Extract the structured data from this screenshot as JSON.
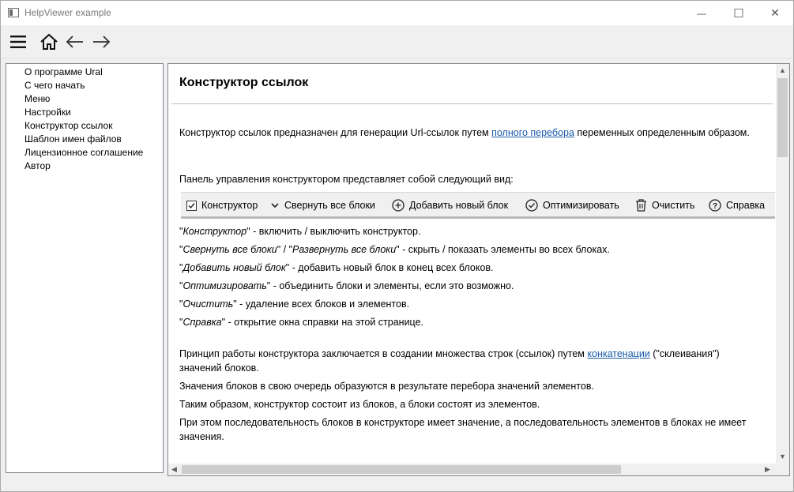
{
  "window": {
    "title": "HelpViewer example",
    "minimize_glyph": "—",
    "maximize_glyph": "☐",
    "close_glyph": "✕"
  },
  "toolbar": {
    "menu_icon": "hamburger-menu-icon",
    "home_icon": "home-icon",
    "back_icon": "arrow-left-icon",
    "forward_icon": "arrow-right-icon"
  },
  "sidebar": {
    "items": [
      {
        "label": "О программе Ural"
      },
      {
        "label": "С чего начать"
      },
      {
        "label": "Меню"
      },
      {
        "label": "Настройки"
      },
      {
        "label": "Конструктор ссылок"
      },
      {
        "label": "Шаблон имен файлов"
      },
      {
        "label": "Лицензионное соглашение"
      },
      {
        "label": "Автор"
      }
    ]
  },
  "doc": {
    "title": "Конструктор ссылок",
    "intro_before": "Конструктор ссылок предназначен для генерации Url-ссылок путем ",
    "intro_link": "полного перебора",
    "intro_after": " переменных определенным образом.",
    "panel_intro": "Панель управления конструктором представляет собой следующий вид:",
    "panel": {
      "constructor": "Конструктор",
      "collapse": "Свернуть все блоки",
      "add_block": "Добавить новый блок",
      "optimize": "Оптимизировать",
      "clear": "Очистить",
      "help": "Справка"
    },
    "desc": [
      {
        "q1": "\"",
        "name": "Конструктор",
        "rest": "\" - включить / выключить конструктор."
      },
      {
        "q1": "\"",
        "name": "Свернуть все блоки",
        "mid": "\" / \"",
        "name2": "Развернуть все блоки",
        "rest": "\" - скрыть / показать элементы во всех блоках."
      },
      {
        "q1": "\"",
        "name": "Добавить новый блок",
        "rest": "\" - добавить новый блок в конец всех блоков."
      },
      {
        "q1": "\"",
        "name": "Оптимизировать",
        "rest": "\" - объединить блоки и элементы, если это возможно."
      },
      {
        "q1": "\"",
        "name": "Очистить",
        "rest": "\" - удаление всех блоков и элементов."
      },
      {
        "q1": "\"",
        "name": "Справка",
        "rest": "\" - открытие окна справки на этой странице."
      }
    ],
    "principle_before": "Принцип работы конструктора заключается в создании множества строк (ссылок) путем ",
    "principle_link": "конкатенации",
    "principle_after": " (\"склеивания\") значений блоков.",
    "line2": "Значения блоков в свою очередь образуются в результате перебора значений элементов.",
    "line3": "Таким образом, конструктор состоит из блоков, а блоки состоят из элементов.",
    "line4": "При этом последовательность блоков в конструкторе имеет значение, а последовательность элементов в блоках не имеет значения."
  }
}
